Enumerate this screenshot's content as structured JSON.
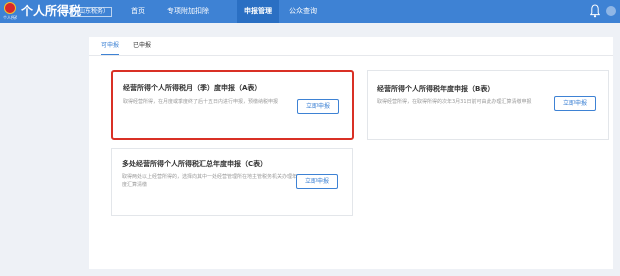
{
  "header": {
    "title": "个人所得税",
    "region": "（山东税务）",
    "emblem_caption": "个人所得税",
    "nav": [
      {
        "label": "首页",
        "active": false
      },
      {
        "label": "专项附加扣除",
        "active": false
      },
      {
        "label": "申报管理",
        "active": true
      },
      {
        "label": "公众查询",
        "active": false
      }
    ],
    "bell_icon": "bell-icon",
    "avatar_icon": "user-avatar"
  },
  "tabs": [
    {
      "label": "可申报",
      "active": true
    },
    {
      "label": "已申报",
      "active": false
    }
  ],
  "cards": [
    {
      "title": "经营所得个人所得税月（季）度申报（A表）",
      "desc": "取得经营所得，在月度或季度终了后十五日内进行申报，预缴纳税申报",
      "button": "立即申报",
      "selected": true
    },
    {
      "title": "经营所得个人所得税年度申报（B表）",
      "desc": "取得经营所得，在取得所得的次年3月31日前可由此办理汇算清缴申报",
      "button": "立即申报",
      "selected": false
    },
    {
      "title": "多处经营所得个人所得税汇总年度申报（C表）",
      "desc": "取得两处以上经营所得的，选择向其中一处经营管理所在地主管税务机关办理年度汇算清缴",
      "button": "立即申报",
      "selected": false
    }
  ],
  "colors": {
    "brand": "#3e82d4",
    "highlight": "#d93025"
  }
}
